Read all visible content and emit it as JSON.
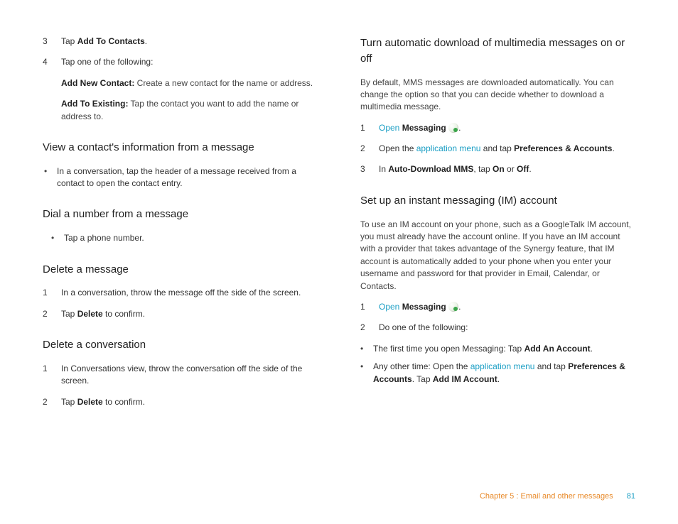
{
  "left": {
    "introSteps": [
      {
        "n": "3",
        "pre": "Tap ",
        "bold": "Add To Contacts",
        "post": "."
      },
      {
        "n": "4",
        "pre": "Tap one of the following:",
        "bold": "",
        "post": ""
      }
    ],
    "subOptions": [
      {
        "bold": "Add New Contact:",
        "rest": " Create a new contact for the name or address."
      },
      {
        "bold": "Add To Existing:",
        "rest": " Tap the contact you want to add the name or address to."
      }
    ],
    "h_view": "View a contact's information from a message",
    "view_bullet": "In a conversation, tap the header of a message received from a contact to open the contact entry.",
    "h_dial": "Dial a number from a message",
    "dial_bullet": "Tap a phone number.",
    "h_delmsg": "Delete a message",
    "delmsg_steps": [
      {
        "n": "1",
        "text": "In a conversation, throw the message off the side of the screen."
      },
      {
        "n": "2",
        "pre": "Tap ",
        "bold": "Delete",
        "post": " to confirm."
      }
    ],
    "h_delconv": "Delete a conversation",
    "delconv_steps": [
      {
        "n": "1",
        "text": "In Conversations view, throw the conversation off the side of the screen."
      },
      {
        "n": "2",
        "pre": "Tap ",
        "bold": "Delete",
        "post": " to confirm."
      }
    ]
  },
  "right": {
    "h_mms": "Turn automatic download of multimedia messages on or off",
    "mms_body": "By default, MMS messages are downloaded automatically. You can change the option so that you can decide whether to download a multimedia message.",
    "mms_steps": {
      "s1_link": "Open",
      "s1_bold": "Messaging",
      "s2_pre": "Open the ",
      "s2_link": "application menu",
      "s2_mid": " and tap ",
      "s2_bold": "Preferences & Accounts",
      "s2_post": ".",
      "s3_pre": "In ",
      "s3_b1": "Auto-Download MMS",
      "s3_mid": ", tap ",
      "s3_b2": "On",
      "s3_or": " or ",
      "s3_b3": "Off",
      "s3_post": "."
    },
    "h_im": "Set up an instant messaging (IM) account",
    "im_body": "To use an IM account on your phone, such as a GoogleTalk IM account, you must already have the account online. If you have an IM account with a provider that takes advantage of the Synergy feature, that IM account is automatically added to your phone when you enter your username and password for that provider in Email, Calendar, or Contacts.",
    "im_steps": {
      "s1_link": "Open",
      "s1_bold": "Messaging",
      "s2_text": "Do one of the following:"
    },
    "im_sub": {
      "a_pre": "The first time you open Messaging: Tap ",
      "a_bold": "Add An Account",
      "a_post": ".",
      "b_pre": "Any other time: Open the ",
      "b_link": "application menu",
      "b_mid": " and tap ",
      "b_b1": "Preferences & Accounts",
      "b_mid2": ". Tap ",
      "b_b2": "Add IM Account",
      "b_post": "."
    }
  },
  "footer": {
    "chapter": "Chapter 5  :  Email and other messages",
    "page": "81"
  }
}
